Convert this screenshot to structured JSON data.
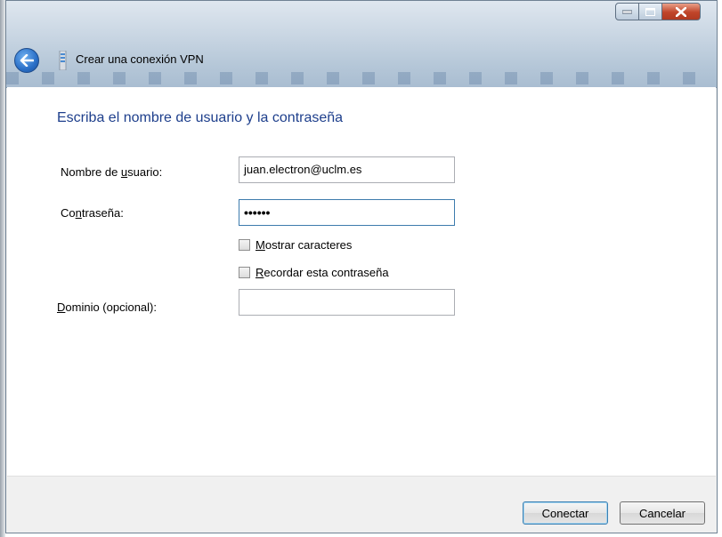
{
  "window": {
    "title": "Crear una conexión VPN"
  },
  "page": {
    "heading": "Escriba el nombre de usuario y la contraseña"
  },
  "form": {
    "username": {
      "label_pre": "Nombre de ",
      "label_access": "u",
      "label_post": "suario:",
      "value": "juan.electron@uclm.es"
    },
    "password": {
      "label_pre": "Co",
      "label_access": "n",
      "label_post": "traseña:",
      "value": "••••••"
    },
    "show_chars": {
      "label_access": "M",
      "label_post": "ostrar caracteres",
      "checked": false
    },
    "remember": {
      "label_access": "R",
      "label_post": "ecordar esta contraseña",
      "checked": false
    },
    "domain": {
      "label_access": "D",
      "label_post": "ominio (opcional):",
      "value": ""
    }
  },
  "buttons": {
    "connect": "Conectar",
    "cancel": "Cancelar"
  },
  "icons": {
    "back": "back-arrow-icon",
    "vpn": "vpn-connection-icon",
    "minimize": "minimize-icon",
    "maximize": "maximize-icon",
    "close": "close-icon"
  }
}
